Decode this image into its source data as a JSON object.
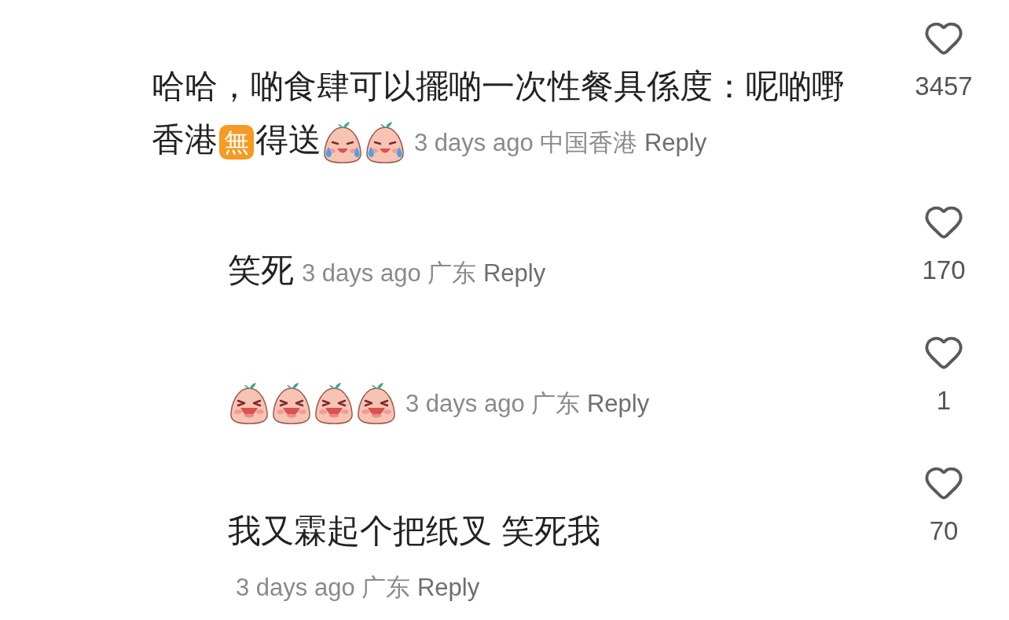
{
  "comments": [
    {
      "is_reply": false,
      "segments": [
        {
          "kind": "text",
          "text": "哈哈，啲食肆可以擺啲一次性餐具係度：呢啲嘢"
        },
        {
          "kind": "text",
          "text": "香港"
        },
        {
          "kind": "badge",
          "text": "無"
        },
        {
          "kind": "text",
          "text": "得送"
        },
        {
          "kind": "crying-sticker"
        },
        {
          "kind": "crying-sticker"
        }
      ],
      "time": "3 days ago",
      "location": "中国香港",
      "reply": "Reply",
      "likes": "3457"
    },
    {
      "is_reply": true,
      "segments": [
        {
          "kind": "text",
          "text": "笑死"
        }
      ],
      "time": "3 days ago",
      "location": "广东",
      "reply": "Reply",
      "likes": "170"
    },
    {
      "is_reply": true,
      "segments": [
        {
          "kind": "laughing-sticker"
        },
        {
          "kind": "laughing-sticker"
        },
        {
          "kind": "laughing-sticker"
        },
        {
          "kind": "laughing-sticker"
        }
      ],
      "time": "3 days ago",
      "location": "广东",
      "reply": "Reply",
      "likes": "1"
    },
    {
      "is_reply": true,
      "segments": [
        {
          "kind": "text",
          "text": "我又霖起个把纸叉  笑死我"
        }
      ],
      "time": "3 days ago",
      "location": "广东",
      "reply": "Reply",
      "likes": "70"
    }
  ]
}
